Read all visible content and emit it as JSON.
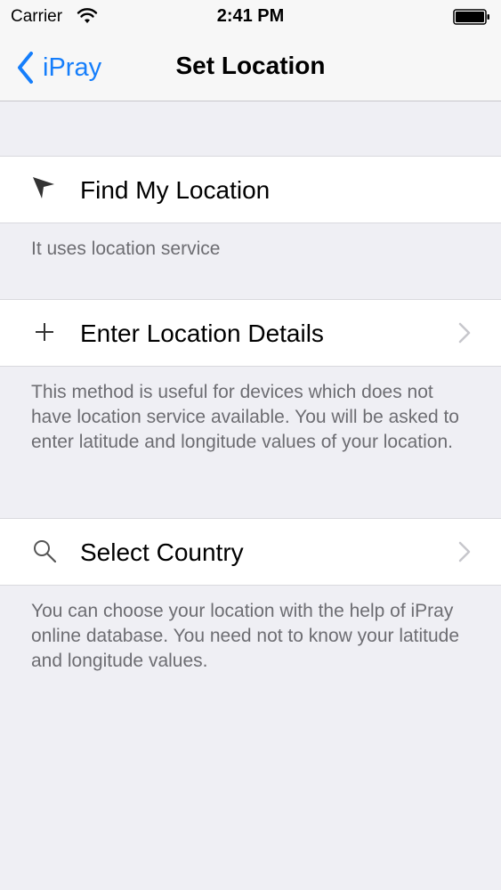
{
  "status_bar": {
    "carrier": "Carrier",
    "time": "2:41 PM"
  },
  "nav": {
    "back_label": "iPray",
    "title": "Set Location"
  },
  "options": {
    "find": {
      "label": "Find My Location",
      "description": "It uses location service",
      "icon": "location-arrow-icon"
    },
    "enter": {
      "label": "Enter Location Details",
      "description": "This method is useful for devices which does not have location service available. You will be asked to enter latitude and longitude values of your location.",
      "icon": "plus-icon"
    },
    "country": {
      "label": "Select Country",
      "description": "You can choose your location with the help of iPray online database. You need not to know your latitude and longitude values.",
      "icon": "search-icon"
    }
  },
  "colors": {
    "accent": "#157efb",
    "background": "#efeff4",
    "footer_text": "#6d6d72"
  }
}
